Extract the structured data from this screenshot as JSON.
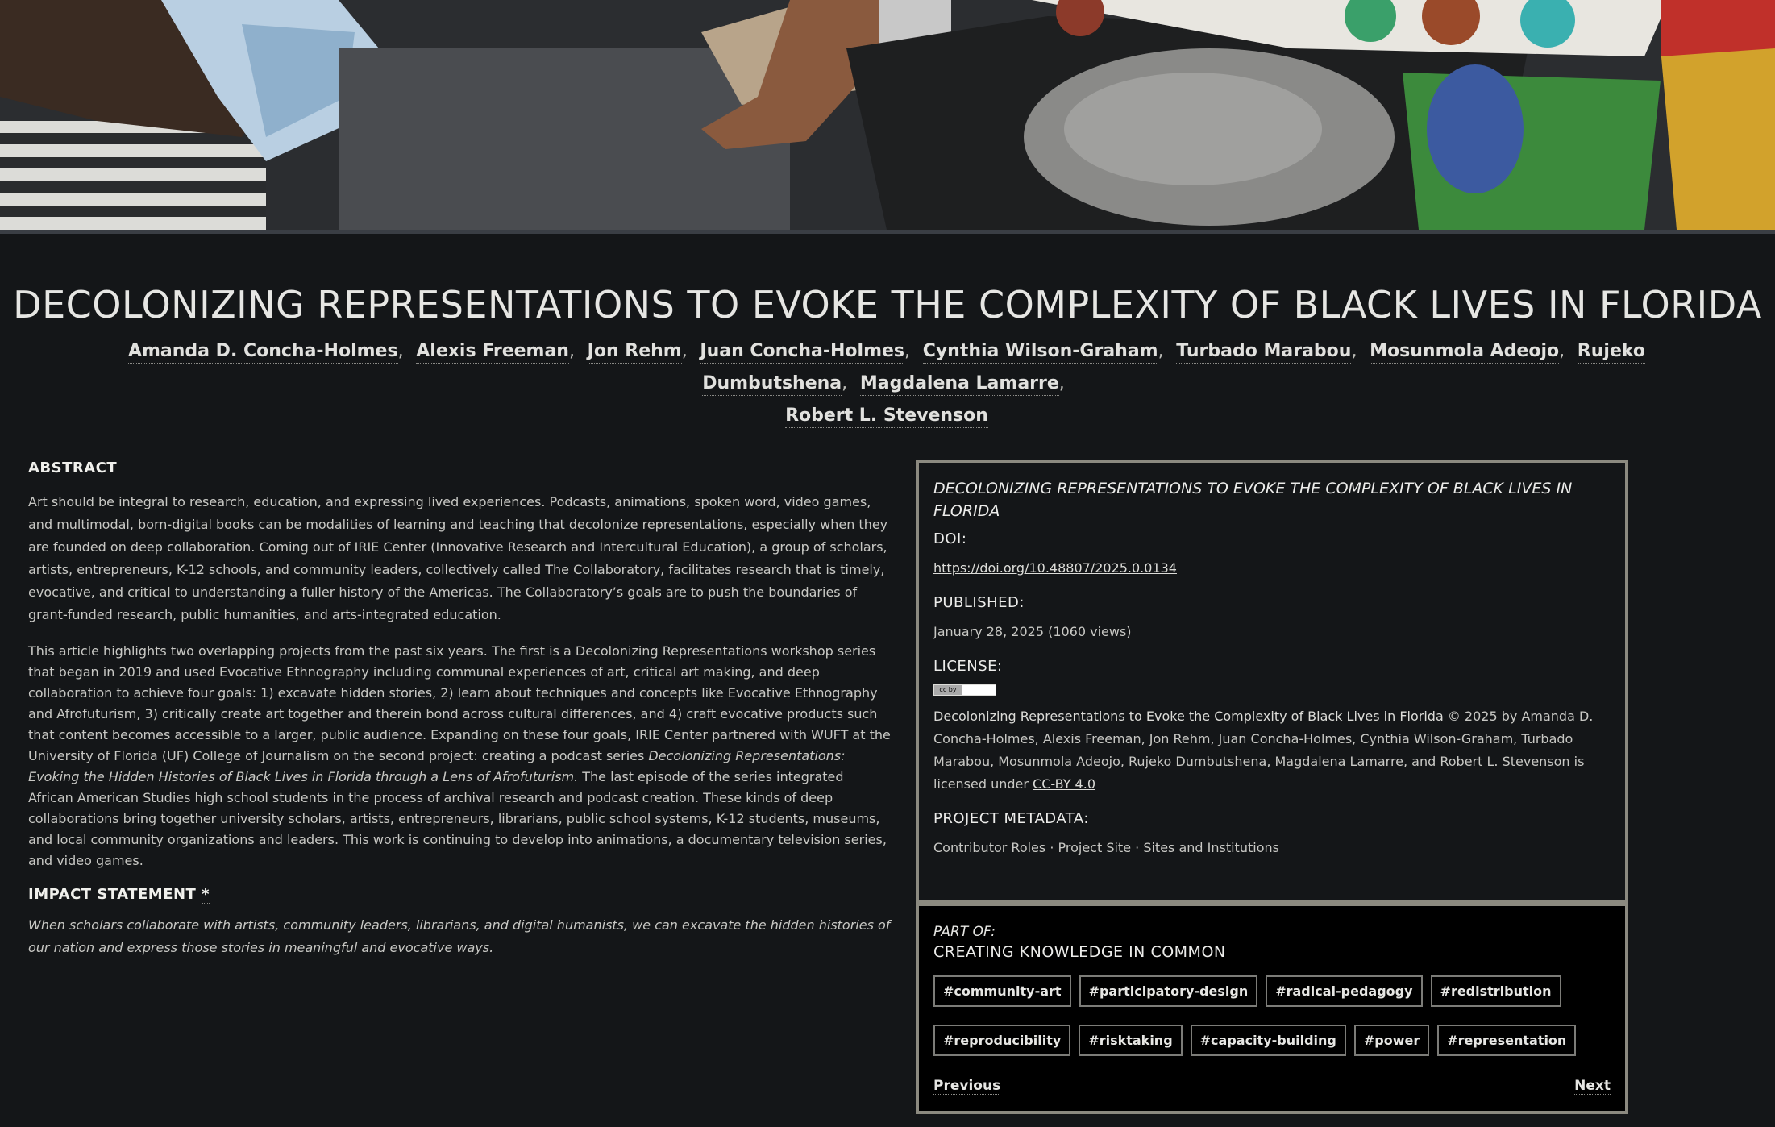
{
  "hero": {
    "image_alt": "Hands painting with metallic and colored paints on dark paper"
  },
  "article": {
    "title": "DECOLONIZING REPRESENTATIONS TO EVOKE THE COMPLEXITY OF BLACK LIVES IN FLORIDA",
    "authors": [
      "Amanda D. Concha-Holmes",
      "Alexis Freeman",
      "Jon Rehm",
      "Juan Concha-Holmes",
      "Cynthia Wilson-Graham",
      "Turbado Marabou",
      "Mosunmola Adeojo",
      "Rujeko Dumbutshena",
      "Magdalena Lamarre",
      "Robert L. Stevenson"
    ],
    "abstract_heading": "ABSTRACT",
    "abstract_p1": "Art should be integral to research, education, and expressing lived experiences. Podcasts, animations, spoken word, video games, and multimodal, born-digital books can be modalities of learning and teaching that decolonize representations, especially when they are founded on deep collaboration. Coming out of IRIE Center (Innovative Research and Intercultural Education), a group of scholars, artists, entrepreneurs, K-12 schools, and community leaders, collectively called The Collaboratory, facilitates research that is timely, evocative, and critical to understanding a fuller history of the Americas. The Collaboratory’s goals are to push the boundaries of grant-funded research, public humanities, and arts-integrated education.",
    "abstract_p2_a": "This article highlights two overlapping projects from the past six years. The first is a Decolonizing Representations workshop series that began in 2019 and used Evocative Ethnography including communal experiences of art, critical art making, and deep collaboration to achieve four goals: 1) excavate hidden stories, 2) learn about techniques and concepts like Evocative Ethnography and Afrofuturism, 3) critically create art together and therein bond across cultural differences, and 4) craft evocative products such that content becomes accessible to a larger, public audience. Expanding on these four goals, IRIE Center partnered with WUFT at the University of Florida (UF) College of Journalism on the second project: creating a podcast series ",
    "abstract_p2_italic": "Decolonizing Representations: Evoking the Hidden Histories of Black Lives in Florida through a Lens of Afrofuturism.",
    "abstract_p2_b": " The last episode of the series integrated African American Studies high school students in the process of archival research and podcast creation. These kinds of deep collaborations bring together university scholars, artists, entrepreneurs, librarians, public school systems, K-12 students, museums, and local community organizations and leaders. This work is continuing to develop into animations, a documentary television series, and video games.",
    "impact_heading": "IMPACT STATEMENT",
    "impact_star": "*",
    "impact_text": "When scholars collaborate with artists, community leaders, librarians, and digital humanists, we can excavate the hidden histories of our nation and express those stories in meaningful and evocative ways."
  },
  "card": {
    "title": "DECOLONIZING REPRESENTATIONS TO EVOKE THE COMPLEXITY OF BLACK LIVES IN FLORIDA",
    "doi_label": "DOI:",
    "doi_link": "https://doi.org/10.48807/2025.0.0134",
    "published_label": "PUBLISHED:",
    "published_value": "January 28, 2025 (1060 views)",
    "license_label": "LICENSE:",
    "license_badge": "cc by",
    "license_title_link": "Decolonizing Representations to Evoke the Complexity of Black Lives in Florida",
    "license_text": " © 2025 by Amanda D. Concha-Holmes, Alexis Freeman, Jon Rehm, Juan Concha-Holmes, Cynthia Wilson-Graham, Turbado Marabou, Mosunmola Adeojo, Rujeko Dumbutshena, Magdalena Lamarre, and Robert L. Stevenson is licensed under ",
    "license_link": "CC-BY 4.0",
    "metadata_label": "PROJECT METADATA:",
    "metadata_items": [
      "Contributor Roles",
      "Project Site",
      "Sites and Institutions"
    ],
    "metadata_sep": " · "
  },
  "partof": {
    "label": "PART OF:",
    "name": "CREATING KNOWLEDGE IN COMMON",
    "tags": [
      "#community-art",
      "#participatory-design",
      "#radical-pedagogy",
      "#redistribution",
      "#reproducibility",
      "#risktaking",
      "#capacity-building",
      "#power",
      "#representation"
    ],
    "previous": "Previous",
    "next": "Next"
  }
}
